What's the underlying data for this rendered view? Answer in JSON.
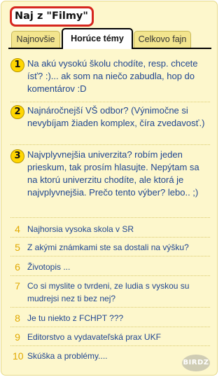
{
  "title": "Naj z \"Filmy\"",
  "tabs": [
    {
      "label": "Najnovšie"
    },
    {
      "label": "Horúce témy",
      "active": true
    },
    {
      "label": "Celkovo fajn"
    }
  ],
  "items": [
    {
      "rank": "1",
      "text": "Na akú vysokú školu chodíte, resp. chcete ísť? :)... ak som na niečo zabudla, hop do komentárov :D"
    },
    {
      "rank": "2",
      "text": "Najnáročnejší VŠ odbor? (Výnimočne si nevybíjam žiaden komplex, číra zvedavosť.)"
    },
    {
      "rank": "3",
      "text": "Najvplyvnejšia univerzita? robím jeden prieskum, tak prosím hlasujte. Nepýtam sa na ktorú univerzitu chodíte, ale ktorá je najvplyvnejšia. Prečo tento výber? lebo.. ;)"
    },
    {
      "rank": "4",
      "text": "Najhorsia vysoka skola v SR"
    },
    {
      "rank": "5",
      "text": "Z akými známkami ste sa dostali na výšku?"
    },
    {
      "rank": "6",
      "text": "Životopis ..."
    },
    {
      "rank": "7",
      "text": "Co si myslite o tvrdeni, ze ludia s vyskou su mudrejsi nez ti bez nej?"
    },
    {
      "rank": "8",
      "text": "Je tu niekto z FCHPT ???"
    },
    {
      "rank": "9",
      "text": "Editorstvo a vydavateľská prax UKF"
    },
    {
      "rank": "10",
      "text": "Skúška a problémy...."
    }
  ],
  "watermark": "BIRDZ",
  "colors": {
    "panel_bg": "#fdf7cc",
    "title_border": "#d6271f",
    "link": "#1f4590",
    "rank_number": "#e0a800",
    "rank_badge": "#ffd600"
  }
}
